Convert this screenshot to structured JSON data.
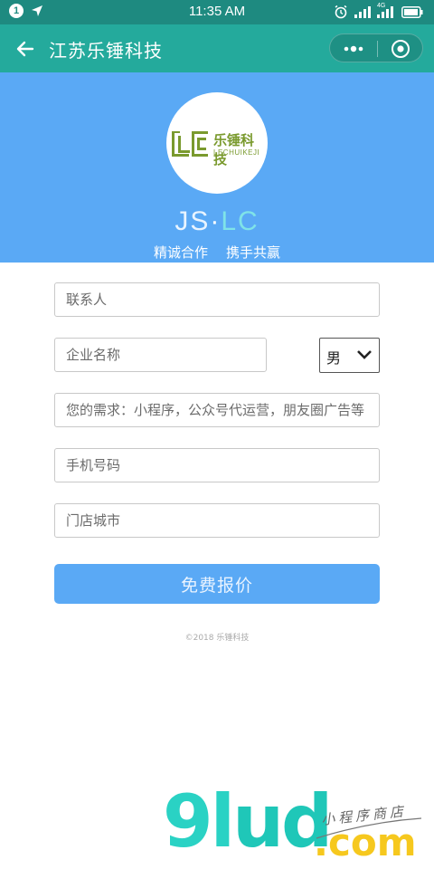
{
  "status_bar": {
    "notification_count": "1",
    "time": "11:35 AM",
    "network_label": "4G"
  },
  "nav": {
    "title": "江苏乐锤科技"
  },
  "banner": {
    "logo_text": "乐锤科技",
    "logo_subtext": "LECHUIKEJI",
    "brand_js": "JS",
    "brand_dot": "·",
    "brand_lc": "LC",
    "slogan_left": "精诚合作",
    "slogan_right": "携手共赢"
  },
  "form": {
    "contact_placeholder": "联系人",
    "company_placeholder": "企业名称",
    "gender_value": "男",
    "needs_placeholder": "您的需求：小程序，公众号代运营，朋友圈广告等",
    "phone_placeholder": "手机号码",
    "city_placeholder": "门店城市",
    "submit_label": "免费报价"
  },
  "footer": {
    "copyright": "©2018 乐锤科技"
  },
  "watermark": {
    "main_9l": "9l",
    "main_ud": "ud",
    "com": ".com",
    "sub": "小程序商店"
  },
  "colors": {
    "status_bar": "#1e8a80",
    "nav_bar": "#24aa9c",
    "banner": "#5aa9f5",
    "button": "#5aa9f5",
    "logo_green": "#7a9a2e"
  }
}
